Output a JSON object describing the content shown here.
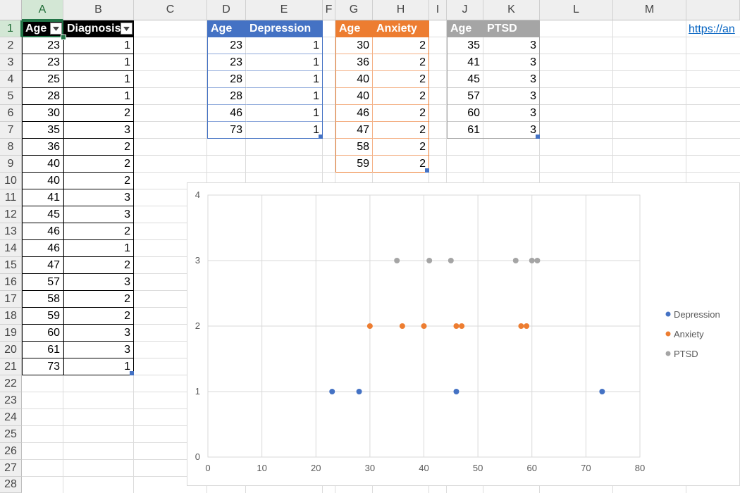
{
  "sheet": {
    "columns": [
      "A",
      "B",
      "C",
      "D",
      "E",
      "F",
      "G",
      "H",
      "I",
      "J",
      "K",
      "L",
      "M"
    ],
    "selected_column": "A",
    "selected_row": 1,
    "rows": [
      "1",
      "2",
      "3",
      "4",
      "5",
      "6",
      "7",
      "8",
      "9",
      "10",
      "11",
      "12",
      "13",
      "14",
      "15",
      "16",
      "17",
      "18",
      "19",
      "20",
      "21",
      "22",
      "23",
      "24",
      "25",
      "26",
      "27",
      "28"
    ]
  },
  "table_main": {
    "headers": [
      "Age",
      "Diagnosis"
    ],
    "rows": [
      [
        "23",
        "1"
      ],
      [
        "23",
        "1"
      ],
      [
        "25",
        "1"
      ],
      [
        "28",
        "1"
      ],
      [
        "30",
        "2"
      ],
      [
        "35",
        "3"
      ],
      [
        "36",
        "2"
      ],
      [
        "40",
        "2"
      ],
      [
        "40",
        "2"
      ],
      [
        "41",
        "3"
      ],
      [
        "45",
        "3"
      ],
      [
        "46",
        "2"
      ],
      [
        "46",
        "1"
      ],
      [
        "47",
        "2"
      ],
      [
        "57",
        "3"
      ],
      [
        "58",
        "2"
      ],
      [
        "59",
        "2"
      ],
      [
        "60",
        "3"
      ],
      [
        "61",
        "3"
      ],
      [
        "73",
        "1"
      ]
    ],
    "header_color": "#000000"
  },
  "table_depression": {
    "headers": [
      "Age",
      "Depression"
    ],
    "rows": [
      [
        "23",
        "1"
      ],
      [
        "23",
        "1"
      ],
      [
        "28",
        "1"
      ],
      [
        "28",
        "1"
      ],
      [
        "46",
        "1"
      ],
      [
        "73",
        "1"
      ]
    ],
    "header_color": "#4472c4"
  },
  "table_anxiety": {
    "headers": [
      "Age",
      "Anxiety"
    ],
    "rows": [
      [
        "30",
        "2"
      ],
      [
        "36",
        "2"
      ],
      [
        "40",
        "2"
      ],
      [
        "40",
        "2"
      ],
      [
        "46",
        "2"
      ],
      [
        "47",
        "2"
      ],
      [
        "58",
        "2"
      ],
      [
        "59",
        "2"
      ]
    ],
    "header_color": "#ed7d31"
  },
  "table_ptsd": {
    "headers": [
      "Age",
      "PTSD"
    ],
    "rows": [
      [
        "35",
        "3"
      ],
      [
        "41",
        "3"
      ],
      [
        "45",
        "3"
      ],
      [
        "57",
        "3"
      ],
      [
        "60",
        "3"
      ],
      [
        "61",
        "3"
      ]
    ],
    "header_color": "#a5a5a5"
  },
  "link_text": "https://an",
  "chart_data": {
    "type": "scatter",
    "title": "",
    "xlabel": "",
    "ylabel": "",
    "xlim": [
      0,
      80
    ],
    "ylim": [
      0,
      4
    ],
    "x_ticks": [
      "0",
      "10",
      "20",
      "30",
      "40",
      "50",
      "60",
      "70",
      "80"
    ],
    "y_ticks": [
      "0",
      "1",
      "2",
      "3",
      "4"
    ],
    "grid": true,
    "legend_position": "right",
    "series": [
      {
        "name": "Depression",
        "color": "#4472c4",
        "points": [
          [
            23,
            1
          ],
          [
            28,
            1
          ],
          [
            46,
            1
          ],
          [
            73,
            1
          ]
        ]
      },
      {
        "name": "Anxiety",
        "color": "#ed7d31",
        "points": [
          [
            30,
            2
          ],
          [
            36,
            2
          ],
          [
            40,
            2
          ],
          [
            46,
            2
          ],
          [
            47,
            2
          ],
          [
            58,
            2
          ],
          [
            59,
            2
          ]
        ]
      },
      {
        "name": "PTSD",
        "color": "#a5a5a5",
        "points": [
          [
            35,
            3
          ],
          [
            41,
            3
          ],
          [
            45,
            3
          ],
          [
            57,
            3
          ],
          [
            60,
            3
          ],
          [
            61,
            3
          ]
        ]
      }
    ]
  }
}
